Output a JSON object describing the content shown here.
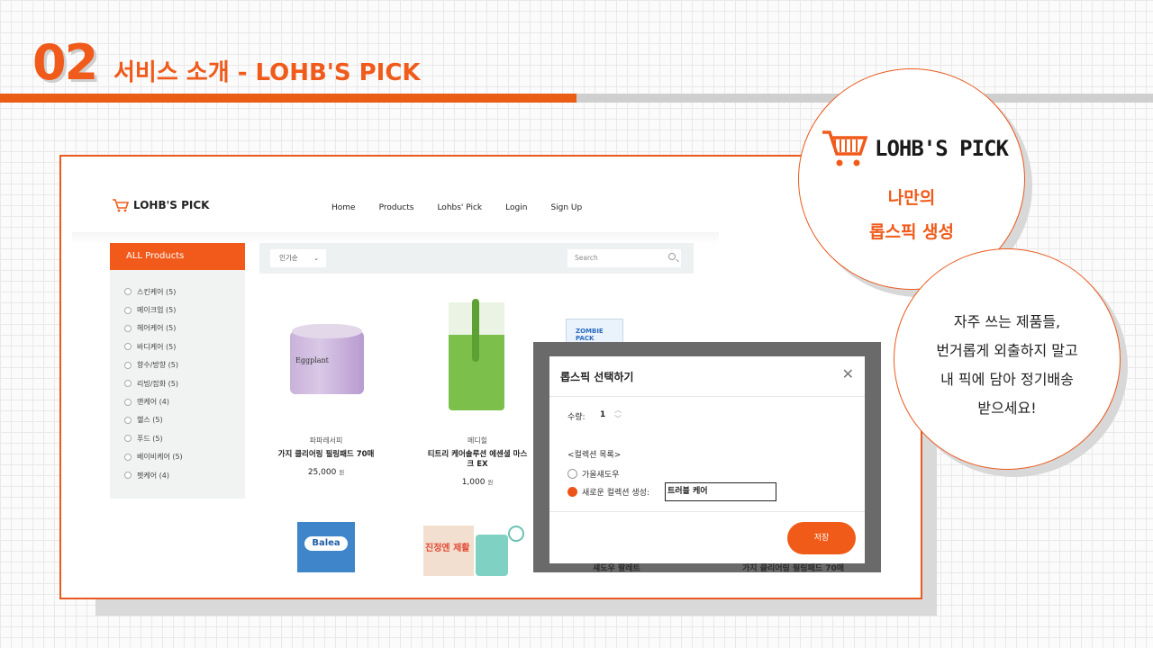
{
  "header": {
    "section_number": "02",
    "section_title": "서비스 소개 - LOHB'S PICK"
  },
  "site": {
    "logo_text": "LOHB'S PICK",
    "nav": [
      "Home",
      "Products",
      "Lohbs' Pick",
      "Login",
      "Sign Up"
    ],
    "sidebar": {
      "heading": "ALL Products",
      "categories": [
        "스킨케어 (5)",
        "메이크업 (5)",
        "헤어케어 (5)",
        "바디케어 (5)",
        "향수/방향 (5)",
        "리빙/잡화 (5)",
        "맨케어 (4)",
        "헬스 (5)",
        "푸드 (5)",
        "베이비케어 (5)",
        "펫케어 (4)"
      ]
    },
    "toolbar": {
      "sort_selected": "인기순",
      "search_placeholder": "Search"
    },
    "products": [
      {
        "brand": "파파레서피",
        "name": "가지 클리어링 필링패드 70매",
        "price": "25,000",
        "unit": "원",
        "image_label": "Eggplant"
      },
      {
        "brand": "메디힐",
        "name_line1": "티트리 케어솔루션 에센셜 마스",
        "name_line2": "크 EX",
        "price": "1,000",
        "unit": "원"
      },
      {
        "image_label": "ZOMBIE PACK"
      },
      {
        "image_label": "Balea"
      },
      {
        "image_label": "진정엔 제활"
      }
    ],
    "behind_modal_names": [
      "섀도우 팔레트",
      "가지 클리어링 필링패드 70매"
    ]
  },
  "modal": {
    "title": "롭스픽 선택하기",
    "close_icon": "close-icon",
    "quantity_label": "수량:",
    "quantity_value": "1",
    "collection_heading": "<컬렉션 목록>",
    "existing_collection": "가을섀도우",
    "new_collection_label": "새로운 컬렉션 생성:",
    "new_collection_value": "트러블 케어",
    "save_label": "저장"
  },
  "callouts": {
    "logo_text": "LOHB'S PICK",
    "circle1_line1": "나만의",
    "circle1_line2": "롭스픽 생성",
    "circle2_lines": [
      "자주 쓰는 제품들,",
      "번거롭게 외출하지 말고",
      "내 픽에 담아 정기배송",
      "받으세요!"
    ]
  },
  "colors": {
    "accent": "#f05a1a",
    "accent_bar": "#e95e14",
    "gray_bar": "#cfcfcf",
    "overlay": "#6a6a6a"
  }
}
